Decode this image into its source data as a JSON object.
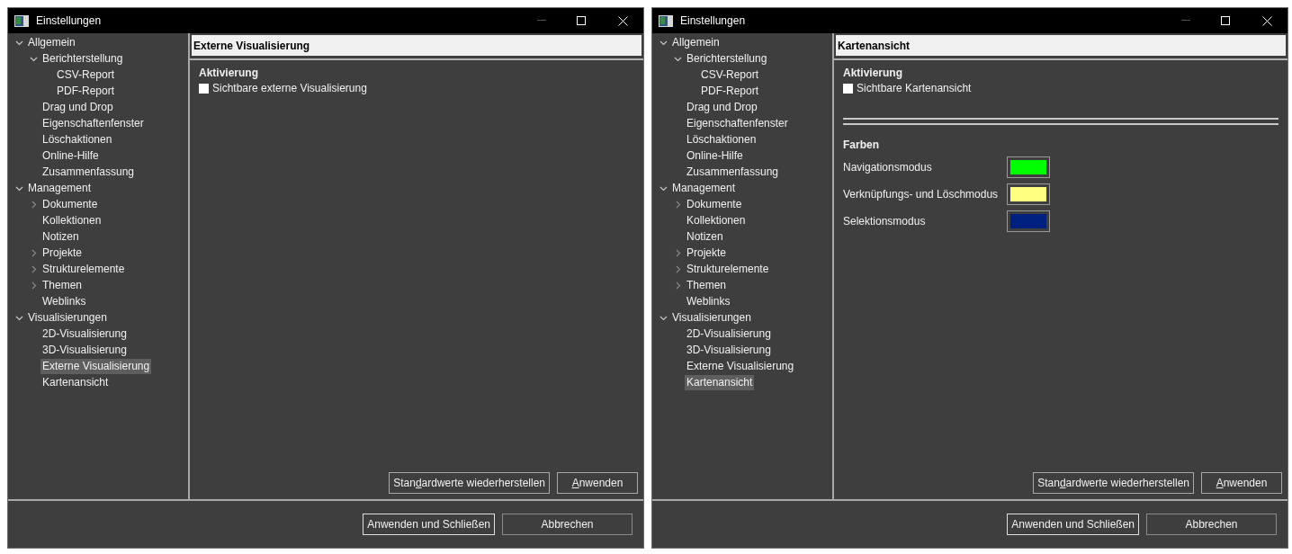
{
  "windows": [
    {
      "title": "Einstellungen",
      "tree": [
        {
          "label": "Allgemein",
          "expanded": true,
          "selected": false,
          "children": [
            {
              "label": "Berichterstellung",
              "expanded": true,
              "selected": false,
              "children": [
                {
                  "label": "CSV-Report",
                  "selected": false
                },
                {
                  "label": "PDF-Report",
                  "selected": false
                }
              ]
            },
            {
              "label": "Drag und Drop",
              "selected": false
            },
            {
              "label": "Eigenschaftenfenster",
              "selected": false
            },
            {
              "label": "Löschaktionen",
              "selected": false
            },
            {
              "label": "Online-Hilfe",
              "selected": false
            },
            {
              "label": "Zusammenfassung",
              "selected": false
            }
          ]
        },
        {
          "label": "Management",
          "expanded": true,
          "selected": false,
          "children": [
            {
              "label": "Dokumente",
              "expanded": false,
              "selected": false
            },
            {
              "label": "Kollektionen",
              "selected": false
            },
            {
              "label": "Notizen",
              "selected": false
            },
            {
              "label": "Projekte",
              "expanded": false,
              "selected": false
            },
            {
              "label": "Strukturelemente",
              "expanded": false,
              "selected": false
            },
            {
              "label": "Themen",
              "expanded": false,
              "selected": false
            },
            {
              "label": "Weblinks",
              "selected": false
            }
          ]
        },
        {
          "label": "Visualisierungen",
          "expanded": true,
          "selected": false,
          "children": [
            {
              "label": "2D-Visualisierung",
              "selected": false
            },
            {
              "label": "3D-Visualisierung",
              "selected": false
            },
            {
              "label": "Externe Visualisierung",
              "selected": true
            },
            {
              "label": "Kartenansicht",
              "selected": false
            }
          ]
        }
      ],
      "page_title": "Externe Visualisierung",
      "groups": [
        {
          "heading": "Aktivierung",
          "items": [
            {
              "kind": "checkbox",
              "label": "Sichtbare externe Visualisierung",
              "checked": false
            }
          ]
        }
      ],
      "page_buttons": [
        {
          "segments": [
            {
              "text": "Stan",
              "underlined": false
            },
            {
              "text": "d",
              "underlined": true
            },
            {
              "text": "ardwerte wiederherstellen",
              "underlined": false
            }
          ]
        },
        {
          "segments": [
            {
              "text": "A",
              "underlined": true
            },
            {
              "text": "nwenden",
              "underlined": false
            }
          ]
        }
      ],
      "footer_buttons": [
        {
          "label": "Anwenden und Schließen",
          "default": true
        },
        {
          "label": "Abbrechen",
          "default": false
        }
      ]
    },
    {
      "title": "Einstellungen",
      "tree": [
        {
          "label": "Allgemein",
          "expanded": true,
          "selected": false,
          "children": [
            {
              "label": "Berichterstellung",
              "expanded": true,
              "selected": false,
              "children": [
                {
                  "label": "CSV-Report",
                  "selected": false
                },
                {
                  "label": "PDF-Report",
                  "selected": false
                }
              ]
            },
            {
              "label": "Drag und Drop",
              "selected": false
            },
            {
              "label": "Eigenschaftenfenster",
              "selected": false
            },
            {
              "label": "Löschaktionen",
              "selected": false
            },
            {
              "label": "Online-Hilfe",
              "selected": false
            },
            {
              "label": "Zusammenfassung",
              "selected": false
            }
          ]
        },
        {
          "label": "Management",
          "expanded": true,
          "selected": false,
          "children": [
            {
              "label": "Dokumente",
              "expanded": false,
              "selected": false
            },
            {
              "label": "Kollektionen",
              "selected": false
            },
            {
              "label": "Notizen",
              "selected": false
            },
            {
              "label": "Projekte",
              "expanded": false,
              "selected": false
            },
            {
              "label": "Strukturelemente",
              "expanded": false,
              "selected": false
            },
            {
              "label": "Themen",
              "expanded": false,
              "selected": false
            },
            {
              "label": "Weblinks",
              "selected": false
            }
          ]
        },
        {
          "label": "Visualisierungen",
          "expanded": true,
          "selected": false,
          "children": [
            {
              "label": "2D-Visualisierung",
              "selected": false
            },
            {
              "label": "3D-Visualisierung",
              "selected": false
            },
            {
              "label": "Externe Visualisierung",
              "selected": false
            },
            {
              "label": "Kartenansicht",
              "selected": true
            }
          ]
        }
      ],
      "page_title": "Kartenansicht",
      "groups": [
        {
          "heading": "Aktivierung",
          "items": [
            {
              "kind": "checkbox",
              "label": "Sichtbare Kartenansicht",
              "checked": false
            }
          ]
        },
        {
          "heading": "Farben",
          "items": [
            {
              "kind": "color",
              "label": "Navigationsmodus",
              "color": "#00ff00"
            },
            {
              "kind": "color",
              "label": "Verknüpfungs- und Löschmodus",
              "color": "#ffff80"
            },
            {
              "kind": "color",
              "label": "Selektionsmodus",
              "color": "#002080"
            }
          ]
        }
      ],
      "page_buttons": [
        {
          "segments": [
            {
              "text": "Stan",
              "underlined": false
            },
            {
              "text": "d",
              "underlined": true
            },
            {
              "text": "ardwerte wiederherstellen",
              "underlined": false
            }
          ]
        },
        {
          "segments": [
            {
              "text": "A",
              "underlined": true
            },
            {
              "text": "nwenden",
              "underlined": false
            }
          ]
        }
      ],
      "footer_buttons": [
        {
          "label": "Anwenden und Schließen",
          "default": true
        },
        {
          "label": "Abbrechen",
          "default": false
        }
      ]
    }
  ]
}
